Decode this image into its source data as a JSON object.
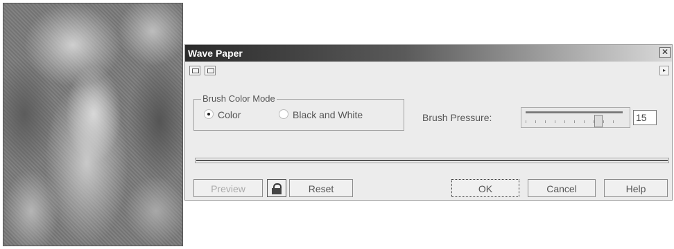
{
  "dialog": {
    "title": "Wave Paper",
    "close_symbol": "✕"
  },
  "toolbar": {
    "icons": [
      "split-preview-icon",
      "single-preview-icon"
    ],
    "arrow_symbol": "▸"
  },
  "brush_color_mode": {
    "legend": "Brush Color Mode",
    "options": [
      {
        "label": "Color",
        "selected": true
      },
      {
        "label": "Black and White",
        "selected": false
      }
    ]
  },
  "brush_pressure": {
    "label": "Brush Pressure:",
    "value": "15",
    "min": 0,
    "max": 20,
    "level": 0.75
  },
  "progress": {
    "fraction": 1.0
  },
  "buttons": {
    "preview": "Preview",
    "reset": "Reset",
    "ok": "OK",
    "cancel": "Cancel",
    "help": "Help"
  }
}
